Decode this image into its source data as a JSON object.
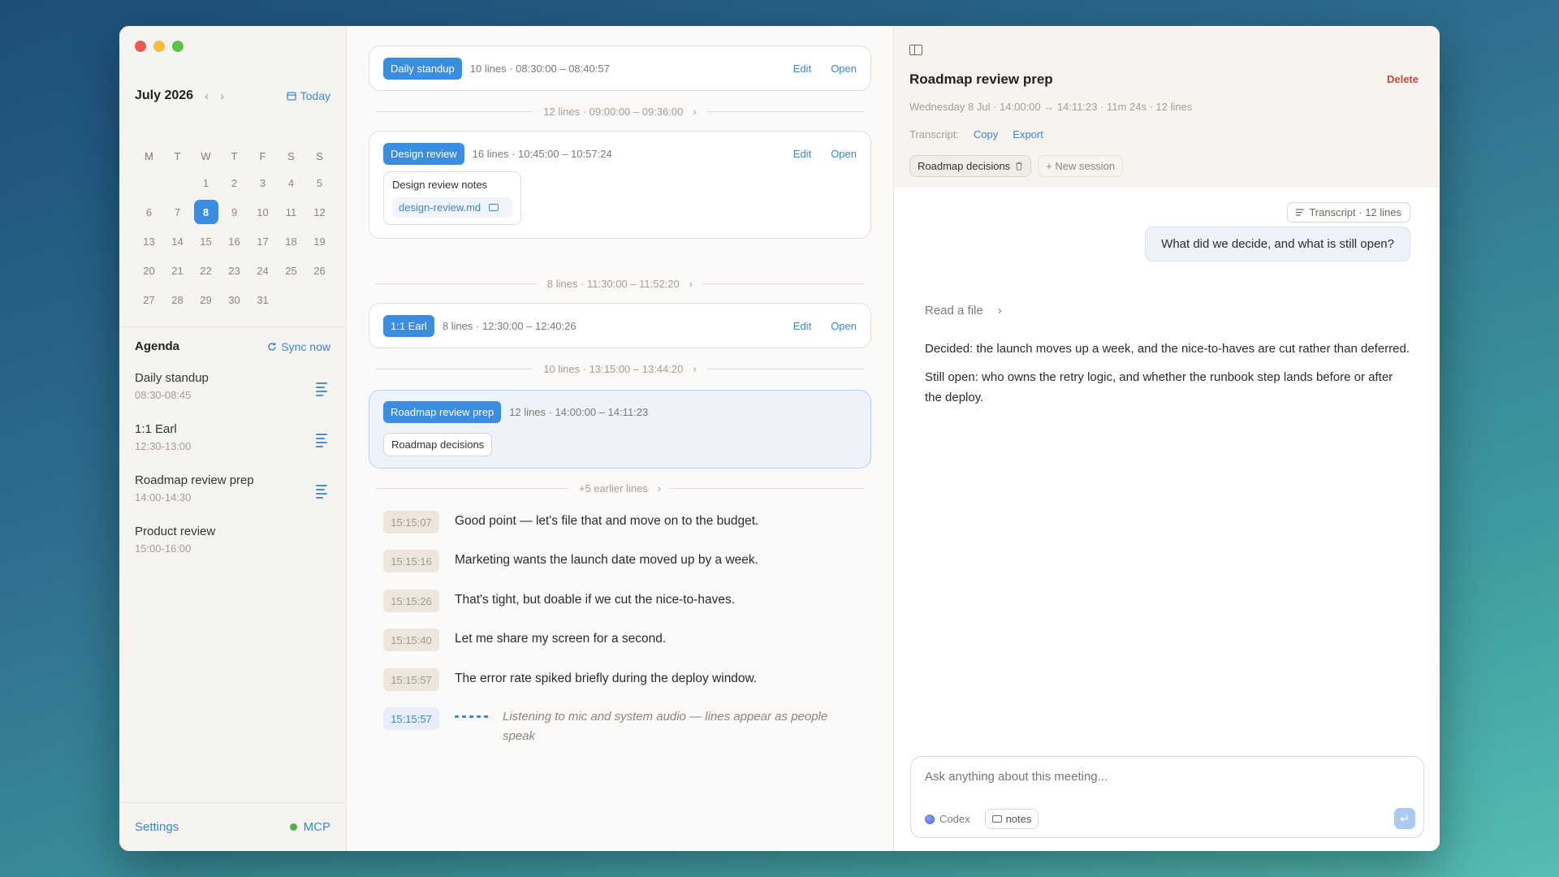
{
  "calendar": {
    "month": "July 2026",
    "prev": "‹",
    "next": "›",
    "today_label": "Today",
    "weekdays": [
      "M",
      "T",
      "W",
      "T",
      "F",
      "S",
      "S"
    ],
    "days": [
      "",
      "",
      "1",
      "2",
      "3",
      "4",
      "5",
      "6",
      "7",
      "8",
      "9",
      "10",
      "11",
      "12",
      "13",
      "14",
      "15",
      "16",
      "17",
      "18",
      "19",
      "20",
      "21",
      "22",
      "23",
      "24",
      "25",
      "26",
      "27",
      "28",
      "29",
      "30",
      "31"
    ],
    "selected": "8"
  },
  "agenda": {
    "title": "Agenda",
    "sync_label": "Sync now",
    "items": [
      {
        "name": "Daily standup",
        "time": "08:30-08:45",
        "has_transcript": true
      },
      {
        "name": "1:1 Earl",
        "time": "12:30-13:00",
        "has_transcript": true
      },
      {
        "name": "Roadmap review prep",
        "time": "14:00-14:30",
        "has_transcript": true
      },
      {
        "name": "Product review",
        "time": "15:00-16:00",
        "has_transcript": false
      }
    ]
  },
  "footer": {
    "settings_label": "Settings",
    "mcp_label": "MCP",
    "mcp_status_color": "#4caf50"
  },
  "sessions": {
    "edit_label": "Edit",
    "open_label": "Open",
    "cards": [
      {
        "title": "Daily standup",
        "meta": "10 lines · 08:30:00 – 08:40:57"
      },
      {
        "title": "Design review",
        "meta": "16 lines · 10:45:00 – 10:57:24",
        "notes_title": "Design review notes",
        "notes_file": "design-review.md"
      },
      {
        "title": "1:1 Earl",
        "meta": "8 lines · 12:30:00 – 12:40:26"
      },
      {
        "title": "Roadmap review prep",
        "meta": "12 lines · 14:00:00 – 14:11:23",
        "tag": "Roadmap decisions"
      }
    ],
    "separators": [
      "12 lines · 09:00:00 – 09:36:00",
      "8 lines · 11:30:00 – 11:52:20",
      "10 lines · 13:15:00 – 13:44:20",
      "+5 earlier lines"
    ],
    "chevron": "›"
  },
  "transcript": {
    "lines": [
      {
        "time": "15:15:07",
        "text": "Good point — let's file that and move on to the budget."
      },
      {
        "time": "15:15:16",
        "text": "Marketing wants the launch date moved up by a week."
      },
      {
        "time": "15:15:26",
        "text": "That's tight, but doable if we cut the nice-to-haves."
      },
      {
        "time": "15:15:40",
        "text": "Let me share my screen for a second."
      },
      {
        "time": "15:15:57",
        "text": "The error rate spiked briefly during the deploy window."
      }
    ],
    "live_time": "15:15:57",
    "listening_text": "Listening to mic and system audio — lines appear as people speak"
  },
  "detail": {
    "title": "Roadmap review prep",
    "delete_label": "Delete",
    "meta": "Wednesday 8 Jul · 14:00:00 → 14:11:23 · 11m 24s · 12 lines",
    "transcript_label": "Transcript:",
    "copy_label": "Copy",
    "export_label": "Export",
    "session_tag": "Roadmap decisions",
    "new_session_label": "+ New session"
  },
  "chat": {
    "transcript_badge": "Transcript · 12 lines",
    "user_message": "What did we decide, and what is still open?",
    "tool_step": "Read a file",
    "answer_1": "Decided: the launch moves up a week, and the nice-to-haves are cut rather than deferred.",
    "answer_2": "Still open: who owns the retry logic, and whether the runbook step lands before or after the deploy.",
    "composer_placeholder": "Ask anything about this meeting...",
    "model_label": "Codex",
    "notes_chip": "notes",
    "send_icon": "↵"
  }
}
